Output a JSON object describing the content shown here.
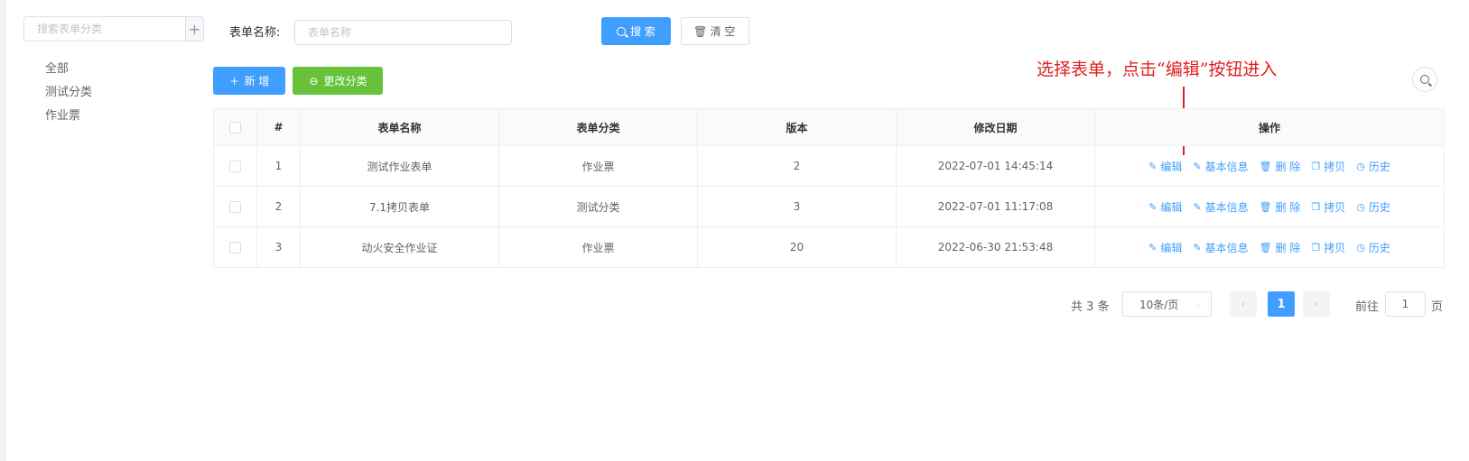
{
  "sidebar": {
    "search_placeholder": "搜索表单分类",
    "add_glyph": "+",
    "items": [
      "全部",
      "测试分类",
      "作业票"
    ]
  },
  "filter": {
    "label": "表单名称:",
    "placeholder": "表单名称",
    "search_label": "搜 索",
    "clear_label": "清 空"
  },
  "toolbar": {
    "add_label": "新 增",
    "change_category_label": "更改分类"
  },
  "annotation": {
    "text": "选择表单，点击“编辑”按钮进入",
    "color": "#e02020"
  },
  "table": {
    "headers": [
      "",
      "#",
      "表单名称",
      "表单分类",
      "版本",
      "修改日期",
      "操作"
    ],
    "rows": [
      {
        "index": "1",
        "name": "测试作业表单",
        "category": "作业票",
        "version": "2",
        "date": "2022-07-01 14:45:14"
      },
      {
        "index": "2",
        "name": "7.1拷贝表单",
        "category": "测试分类",
        "version": "3",
        "date": "2022-07-01 11:17:08"
      },
      {
        "index": "3",
        "name": "动火安全作业证",
        "category": "作业票",
        "version": "20",
        "date": "2022-06-30 21:53:48"
      }
    ],
    "actions": [
      {
        "label": "编辑",
        "icon": "edit-icon",
        "glyph": "✎"
      },
      {
        "label": "基本信息",
        "icon": "edit-icon",
        "glyph": "✎"
      },
      {
        "label": "删 除",
        "icon": "trash-icon",
        "glyph": "🗑"
      },
      {
        "label": "拷贝",
        "icon": "copy-icon",
        "glyph": "❐"
      },
      {
        "label": "历史",
        "icon": "clock-icon",
        "glyph": "◷"
      }
    ]
  },
  "pagination": {
    "total": "共 3 条",
    "page_size": "10条/页",
    "current": "1",
    "goto_label": "前往",
    "goto_value": "1",
    "page_suffix": "页"
  },
  "colors": {
    "primary": "#409eff",
    "success": "#67c23a"
  }
}
